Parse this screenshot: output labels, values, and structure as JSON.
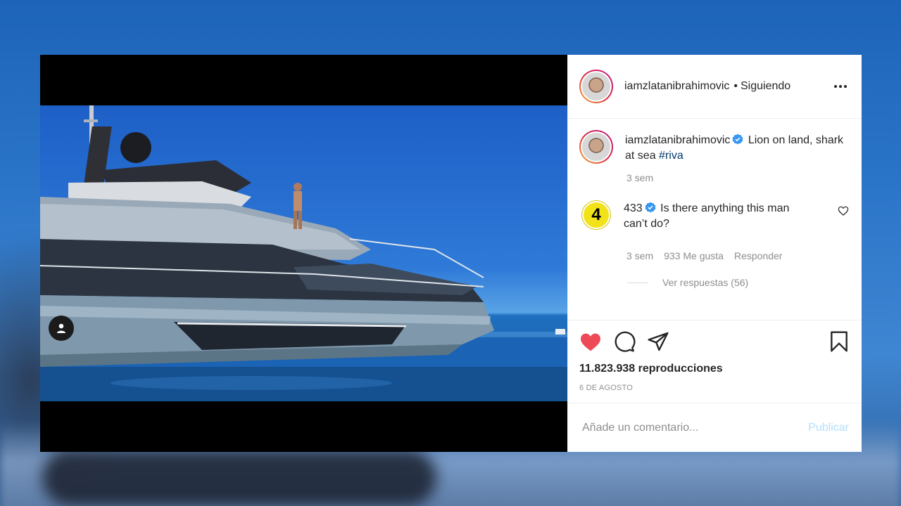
{
  "post": {
    "author": "iamzlatanibrahimovic",
    "separator": "•",
    "follow_status": "Siguiendo",
    "caption": {
      "username": "iamzlatanibrahimovic",
      "text": "Lion on land, shark at sea",
      "hashtag": "#riva",
      "time": "3 sem"
    },
    "comment": {
      "avatar_text": "4",
      "username": "433",
      "text": "Is there anything this man can’t do?",
      "time": "3 sem",
      "likes": "933 Me gusta",
      "reply": "Responder",
      "view_replies": "Ver respuestas (56)"
    },
    "views": "11.823.938 reproducciones",
    "date": "6 DE AGOSTO",
    "comment_placeholder": "Añade un comentario...",
    "publish_label": "Publicar"
  },
  "colors": {
    "like_red": "#ed4956",
    "verified_blue": "#3897f0",
    "hashtag": "#00376b",
    "publish_disabled": "#b2dffc"
  }
}
